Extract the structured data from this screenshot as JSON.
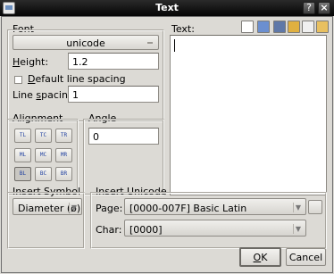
{
  "window": {
    "title": "Text"
  },
  "font_group": {
    "label": "Font",
    "font_button": "unicode",
    "height_label": "Height:",
    "height_value": "1.2",
    "default_spacing_label": "Default line spacing",
    "line_spacing_label": "Line spacing:",
    "line_spacing_value": "1"
  },
  "alignment_group": {
    "label": "Alignment",
    "buttons": [
      "TL",
      "TC",
      "TR",
      "ML",
      "MC",
      "MR",
      "BL",
      "BC",
      "BR"
    ]
  },
  "angle_group": {
    "label": "Angle",
    "value": "0"
  },
  "text_group": {
    "label": "Text:"
  },
  "insert_symbol": {
    "label": "Insert Symbol",
    "selected": "Diameter (ø)"
  },
  "insert_unicode": {
    "label": "Insert Unicode",
    "page_label": "Page:",
    "page_value": "[0000-007F] Basic Latin",
    "char_label": "Char:",
    "char_value": "[0000]"
  },
  "buttons": {
    "ok": "OK",
    "cancel": "Cancel"
  }
}
